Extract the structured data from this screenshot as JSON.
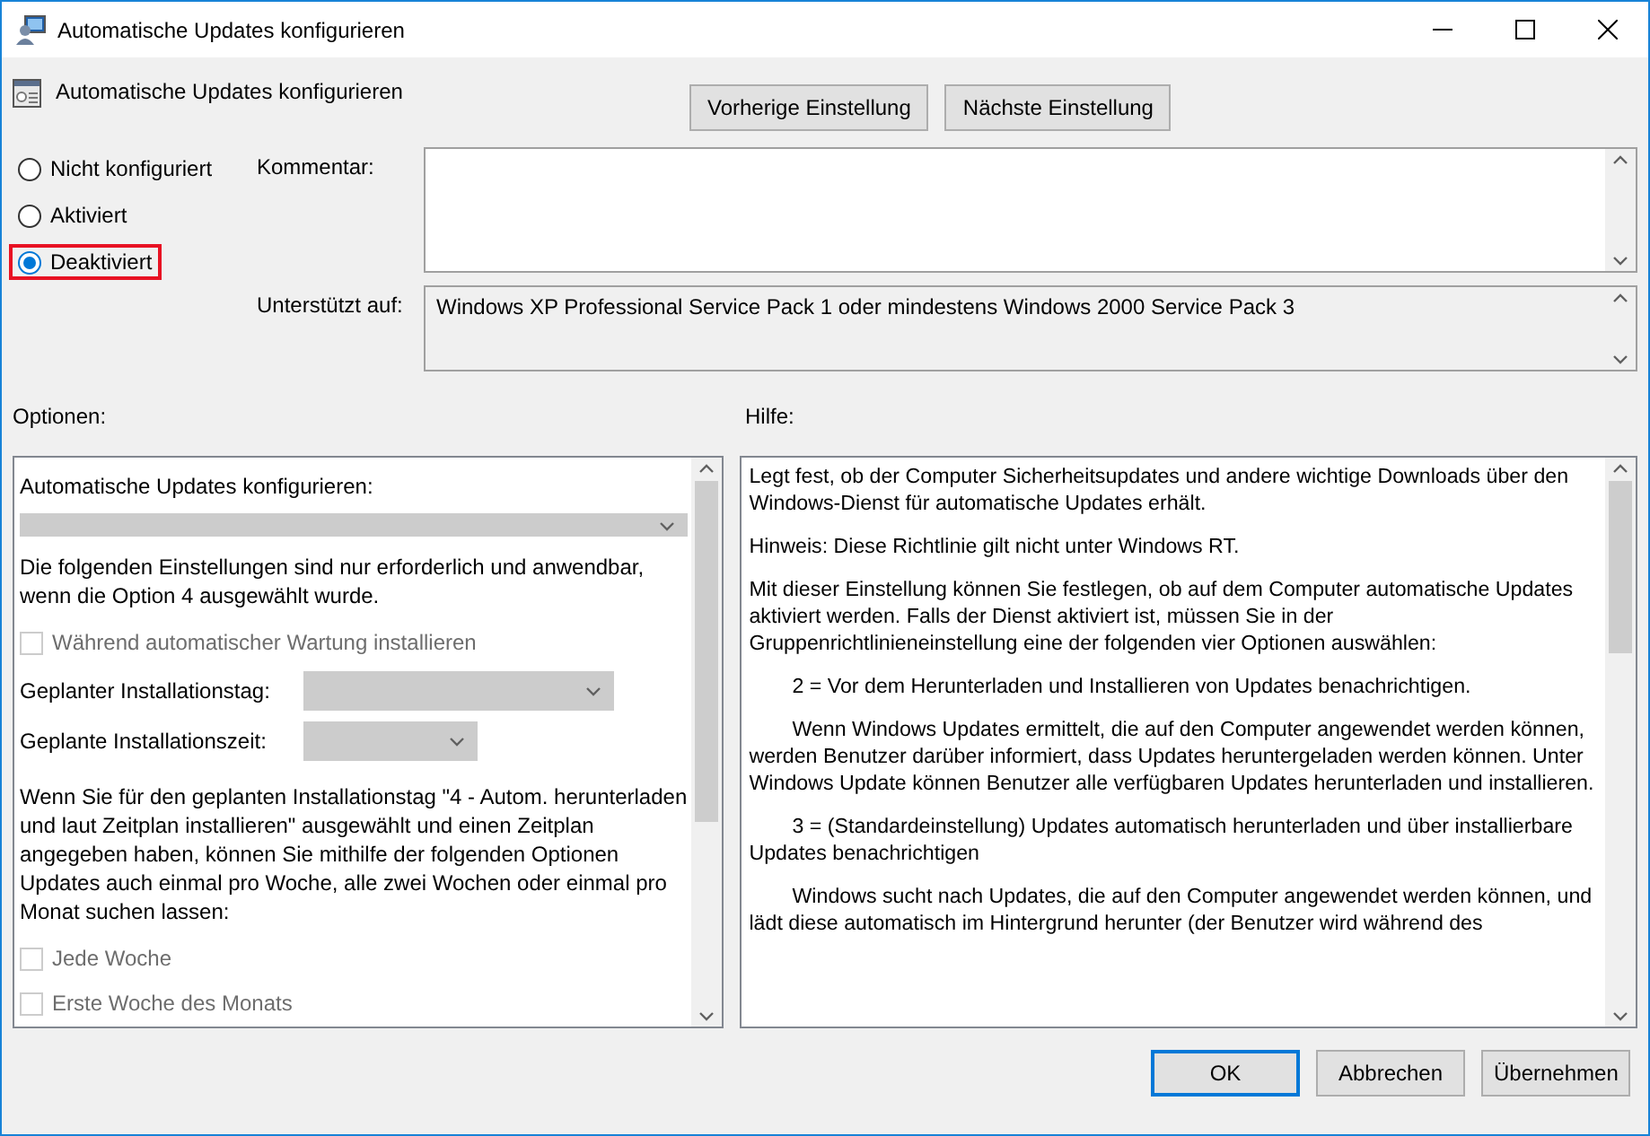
{
  "window": {
    "title": "Automatische Updates konfigurieren"
  },
  "header": {
    "title": "Automatische Updates konfigurieren",
    "buttons": [
      {
        "label": "Vorherige Einstellung"
      },
      {
        "label": "Nächste Einstellung"
      }
    ]
  },
  "state_options": [
    {
      "label": "Nicht konfiguriert",
      "selected": false,
      "highlighted": false
    },
    {
      "label": "Aktiviert",
      "selected": false,
      "highlighted": false
    },
    {
      "label": "Deaktiviert",
      "selected": true,
      "highlighted": true
    }
  ],
  "comment": {
    "label": "Kommentar:"
  },
  "supported": {
    "label": "Unterstützt auf:",
    "value": "Windows XP Professional Service Pack 1 oder mindestens Windows 2000 Service Pack 3"
  },
  "options": {
    "heading": "Optionen:",
    "items": [
      {
        "kind": "label",
        "text": "Automatische Updates konfigurieren:"
      },
      {
        "kind": "dropdown",
        "disabled": true
      },
      {
        "kind": "text",
        "text": "Die folgenden Einstellungen sind nur erforderlich und anwendbar, wenn die Option 4 ausgewählt wurde."
      },
      {
        "kind": "checkbox",
        "label": "Während automatischer Wartung installieren",
        "checked": false,
        "disabled": true
      },
      {
        "kind": "labeled_dropdown",
        "label": "Geplanter Installationstag:",
        "disabled": true
      },
      {
        "kind": "labeled_dropdown",
        "label": "Geplante Installationszeit:",
        "disabled": true
      },
      {
        "kind": "text",
        "text": "Wenn Sie für den geplanten Installationstag \"4 - Autom. herunterladen und laut Zeitplan installieren\" ausgewählt und einen Zeitplan angegeben haben, können Sie mithilfe der folgenden Optionen Updates auch einmal pro Woche, alle zwei Wochen oder einmal pro Monat suchen lassen:"
      },
      {
        "kind": "checkbox",
        "label": "Jede Woche",
        "checked": false,
        "disabled": true
      },
      {
        "kind": "checkbox",
        "label": "Erste Woche des Monats",
        "checked": false,
        "disabled": true
      }
    ]
  },
  "help": {
    "heading": "Hilfe:",
    "paragraphs": [
      {
        "kind": "plain",
        "text": "Legt fest, ob der Computer Sicherheitsupdates und andere wichtige Downloads über den Windows-Dienst für automatische Updates erhält."
      },
      {
        "kind": "plain",
        "text": "Hinweis: Diese Richtlinie gilt nicht unter Windows RT."
      },
      {
        "kind": "plain",
        "text": "Mit dieser Einstellung können Sie festlegen, ob auf dem Computer automatische Updates aktiviert werden. Falls der Dienst aktiviert ist, müssen Sie in der Gruppenrichtlinieneinstellung eine der folgenden vier Optionen auswählen:"
      },
      {
        "kind": "indented",
        "text": "2 = Vor dem Herunterladen und Installieren von Updates benachrichtigen."
      },
      {
        "kind": "indented",
        "text": "Wenn Windows Updates ermittelt, die auf den Computer angewendet werden können, werden Benutzer darüber informiert, dass Updates heruntergeladen werden können. Unter Windows Update können Benutzer alle verfügbaren Updates herunterladen und installieren."
      },
      {
        "kind": "indented",
        "text": "3 = (Standardeinstellung) Updates automatisch herunterladen und über installierbare Updates benachrichtigen"
      },
      {
        "kind": "indented",
        "text": "Windows sucht nach Updates, die auf den Computer angewendet werden können, und lädt diese automatisch im Hintergrund herunter (der Benutzer wird während des"
      }
    ]
  },
  "footer": {
    "buttons": [
      {
        "label": "OK",
        "default": true
      },
      {
        "label": "Abbrechen",
        "default": false
      },
      {
        "label": "Übernehmen",
        "default": false
      }
    ]
  }
}
